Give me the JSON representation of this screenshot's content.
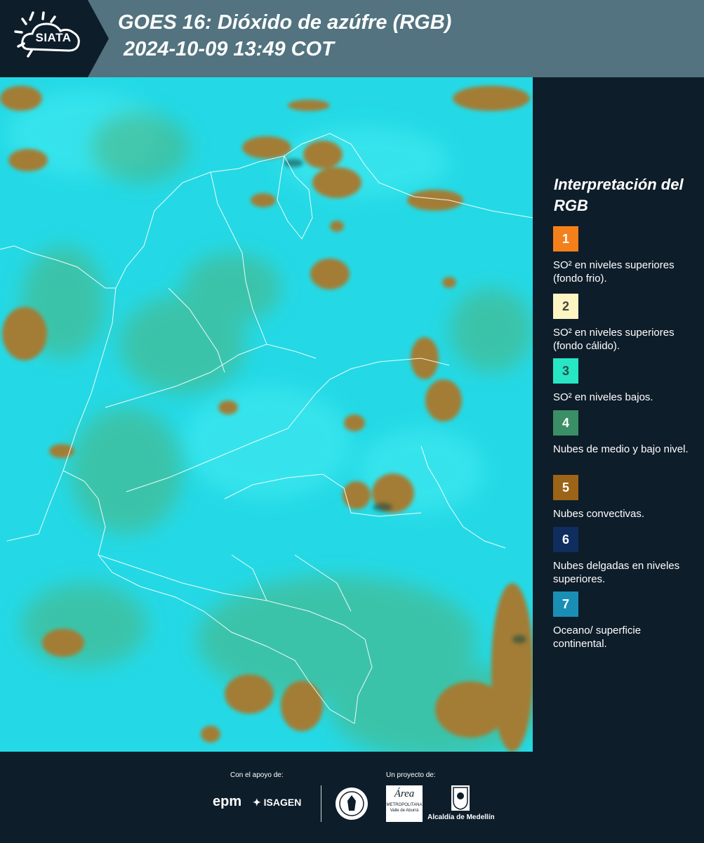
{
  "header": {
    "logo_text": "SIATA",
    "title": "GOES 16: Dióxido de azúfre (RGB)",
    "subtitle": "2024-10-09 13:49 COT"
  },
  "map": {
    "description_icon": "satellite-rgb-map",
    "colors": {
      "background": "#22d8e4",
      "convective": "#a87a2a",
      "mid_low": "#4aa86a",
      "border": "#ffffff"
    }
  },
  "legend": {
    "title": "Interpretación del RGB",
    "items": [
      {
        "number": "1",
        "color": "#f4801c",
        "text_color": "#ffffff",
        "label": "SO² en niveles superiores (fondo frio)."
      },
      {
        "number": "2",
        "color": "#fdf6c2",
        "text_color": "#444444",
        "label": "SO² en niveles superiores (fondo cálido)."
      },
      {
        "number": "3",
        "color": "#26e6c4",
        "text_color": "#2a4f4a",
        "label": "SO² en niveles bajos."
      },
      {
        "number": "4",
        "color": "#3a8f66",
        "text_color": "#ffffff",
        "label": "Nubes de medio y bajo nivel."
      },
      {
        "number": "5",
        "color": "#9c6417",
        "text_color": "#ffffff",
        "label": "Nubes convectivas."
      },
      {
        "number": "6",
        "color": "#0f2d5e",
        "text_color": "#ffffff",
        "label": "Nubes delgadas en niveles superiores."
      },
      {
        "number": "7",
        "color": "#1a8fb5",
        "text_color": "#ffffff",
        "label": "Oceano/ superficie continental."
      }
    ]
  },
  "footer": {
    "support_label": "Con el apoyo de:",
    "project_label": "Un proyecto de:",
    "epm": "epm",
    "isagen": "ISAGEN",
    "metro_line1": "Área",
    "metro_line2": "METROPOLITANA",
    "metro_line3": "Valle de Aburrá",
    "alcaldia": "Alcaldía de Medellín"
  }
}
